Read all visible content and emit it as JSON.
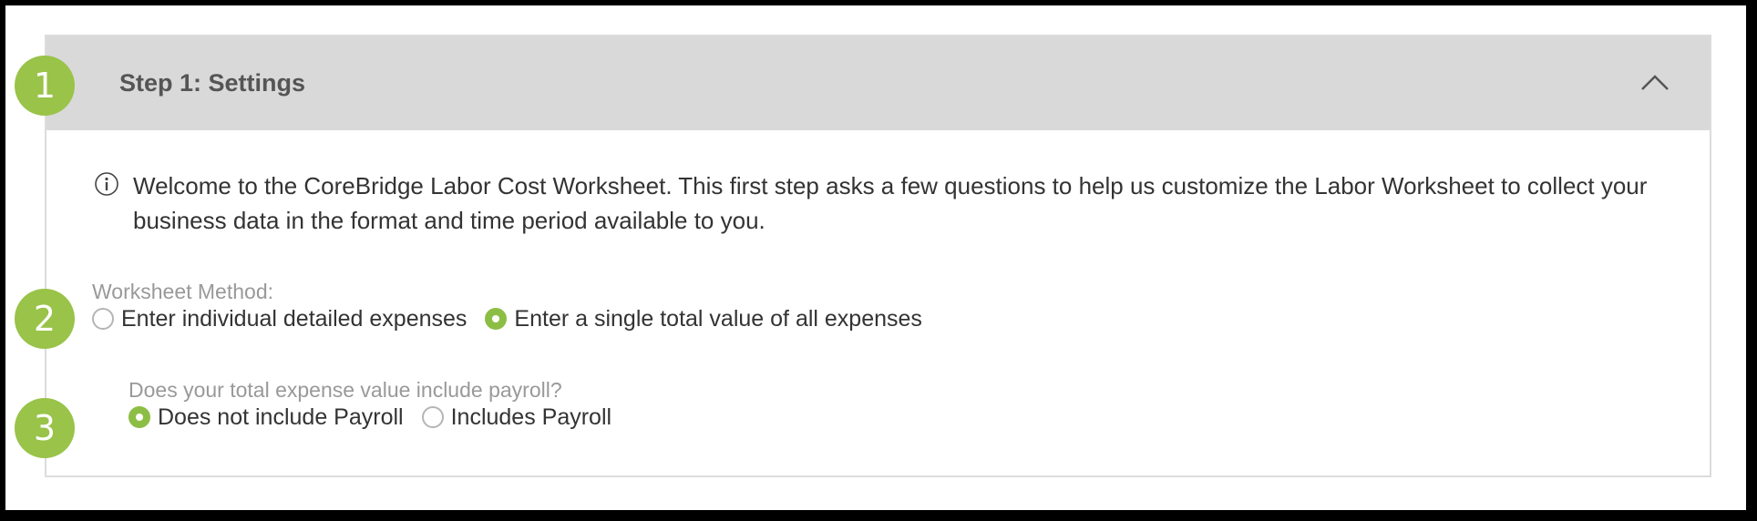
{
  "step": {
    "title": "Step 1: Settings",
    "collapse_icon": "chevron-up-icon"
  },
  "info": {
    "icon": "info-icon",
    "text": "Welcome to the CoreBridge Labor Cost Worksheet. This first step asks a few questions to help us customize the Labor Worksheet to collect your business data in the format and time period available to you."
  },
  "worksheet_method": {
    "label": "Worksheet Method:",
    "options": [
      {
        "label": "Enter individual detailed expenses",
        "checked": false
      },
      {
        "label": "Enter a single total value of all expenses",
        "checked": true
      }
    ]
  },
  "payroll": {
    "question": "Does your total expense value include payroll?",
    "options": [
      {
        "label": "Does not include Payroll",
        "checked": true
      },
      {
        "label": "Includes Payroll",
        "checked": false
      }
    ]
  },
  "badges": [
    "1",
    "2",
    "3"
  ],
  "colors": {
    "accent": "#8cbe45",
    "badge": "#99c349",
    "header_bg": "#d9d9d9"
  }
}
